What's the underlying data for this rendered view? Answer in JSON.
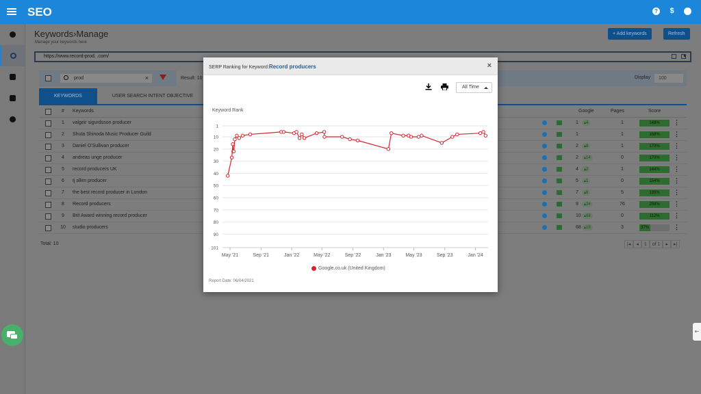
{
  "app": {
    "title": "SEO"
  },
  "topbar": {
    "help_icon": "?",
    "dollar_icon": "$"
  },
  "page": {
    "title": "Keywords",
    "title_sep": "›",
    "title_sub": "Manage",
    "subtitle": "Manage your keywords here",
    "add_keywords": "Add keywords",
    "refresh": "Refresh",
    "url": "https://www.record-prod.          .com/"
  },
  "filters": {
    "search_value": "prod",
    "result_label": "Result: 10",
    "display_label": "Display",
    "display_value": "100"
  },
  "tabs": [
    "KEYWORDS",
    "USER SEARCH INTENT OBJECTIVE"
  ],
  "table": {
    "headers": {
      "num": "#",
      "keywords": "Keywords",
      "google": "Google",
      "pages": "Pages",
      "score": "Score"
    },
    "rows": [
      {
        "num": "1",
        "keyword": "valgeir sigurdsson producer",
        "google": "1",
        "change": "4",
        "pages": "1",
        "score": "148%"
      },
      {
        "num": "2",
        "keyword": "Shuta Shinoda Music Producer Guild",
        "google": "1",
        "change": "",
        "pages": "1",
        "score": "168%"
      },
      {
        "num": "3",
        "keyword": "Daniel O'Sullivan producer",
        "google": "2",
        "change": "8",
        "pages": "1",
        "score": "170%"
      },
      {
        "num": "4",
        "keyword": "andreas unge producer",
        "google": "2",
        "change": "14",
        "pages": "0",
        "score": "170%"
      },
      {
        "num": "5",
        "keyword": "record producers UK",
        "google": "4",
        "change": "2",
        "pages": "1",
        "score": "144%"
      },
      {
        "num": "6",
        "keyword": "tj allen producer",
        "google": "5",
        "change": "1",
        "pages": "0",
        "score": "154%"
      },
      {
        "num": "7",
        "keyword": "the best record producer in London",
        "google": "7",
        "change": "6",
        "pages": "5",
        "score": "135%"
      },
      {
        "num": "8",
        "keyword": "Record producers",
        "google": "9",
        "change": "34",
        "pages": "76",
        "score": "259%"
      },
      {
        "num": "9",
        "keyword": "Brit Award winning record producer",
        "google": "10",
        "change": "68",
        "pages": "0",
        "score": "112%"
      },
      {
        "num": "10",
        "keyword": "studio producers",
        "google": "68",
        "change": "16",
        "pages": "3",
        "score": "37%"
      }
    ],
    "total": "Total: 10",
    "pager": {
      "page": "1",
      "of": "of 1"
    }
  },
  "modal": {
    "title_prefix": "SERP Ranking for Keyword:",
    "title_keyword": "Record producers",
    "close": "×",
    "period": "All Time",
    "y_title": "Keyword Rank",
    "legend": "Google.co.uk (United Kingdom)",
    "report_date": "Report Date: 06/04/2021"
  },
  "chart_data": {
    "type": "line",
    "title": "",
    "ylabel": "Keyword Rank",
    "xlabel": "",
    "y_ticks": [
      1,
      10,
      20,
      30,
      40,
      50,
      60,
      70,
      80,
      90,
      101
    ],
    "ylim": [
      1,
      101
    ],
    "y_reversed": true,
    "x_ticks": [
      "May '21",
      "Sep '21",
      "Jan '22",
      "May '22",
      "Sep '22",
      "Jan '23",
      "May '23",
      "Sep '23",
      "Jan '24"
    ],
    "series": [
      {
        "name": "Google.co.uk (United Kingdom)",
        "color": "#d9232e",
        "x": [
          "2021-04-22",
          "2021-05-08",
          "2021-05-12",
          "2021-05-14",
          "2021-05-16",
          "2021-05-20",
          "2021-05-28",
          "2021-06-06",
          "2021-06-20",
          "2021-07-20",
          "2021-11-20",
          "2021-11-30",
          "2022-01-10",
          "2022-01-20",
          "2022-02-01",
          "2022-02-10",
          "2022-02-20",
          "2022-04-10",
          "2022-05-10",
          "2022-05-11",
          "2022-07-20",
          "2022-08-20",
          "2022-09-20",
          "2023-01-20",
          "2023-02-01",
          "2023-03-20",
          "2023-04-10",
          "2023-04-20",
          "2023-05-20",
          "2023-06-01",
          "2023-08-20",
          "2023-10-01",
          "2023-10-20",
          "2024-01-20",
          "2024-02-01",
          "2024-02-10"
        ],
        "y": [
          42,
          27,
          16,
          22,
          22,
          12,
          9,
          11,
          9,
          8,
          6,
          6,
          7,
          6,
          11,
          8,
          11,
          7,
          6,
          10,
          10,
          12,
          13,
          20,
          7,
          9,
          9,
          10,
          10,
          9,
          15,
          10,
          8,
          7,
          6,
          9
        ]
      }
    ]
  },
  "colors": {
    "brand": "#1c86da",
    "series": "#d9232e",
    "score_fill": "#2e6b2e",
    "chat": "#49b06b"
  }
}
